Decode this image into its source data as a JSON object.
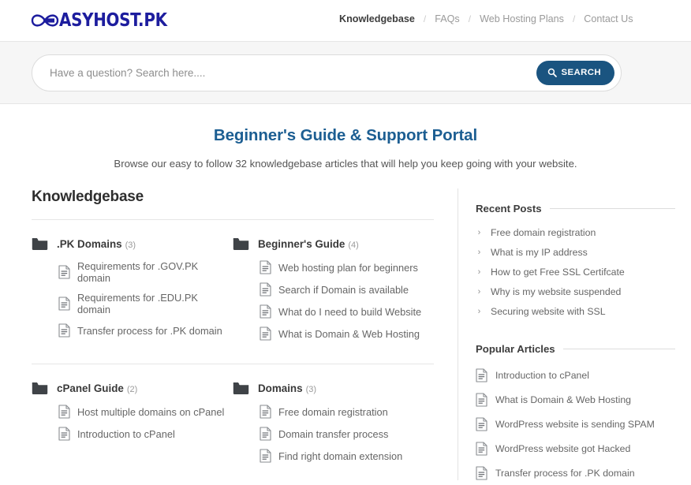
{
  "header": {
    "logo_text": "ASYHOST.PK",
    "logo_alt": "easyhost-pk-logo",
    "nav": [
      {
        "label": "Knowledgebase",
        "active": true
      },
      {
        "label": "FAQs",
        "active": false
      },
      {
        "label": "Web Hosting Plans",
        "active": false
      },
      {
        "label": "Contact Us",
        "active": false
      }
    ],
    "nav_separator": "/"
  },
  "search": {
    "placeholder": "Have a question? Search here....",
    "value": "",
    "button_label": "SEARCH",
    "button_icon": "search-icon",
    "button_color": "#1a5480"
  },
  "hero": {
    "title": "Beginner's Guide & Support Portal",
    "title_color": "#1c5e92",
    "subtitle": "Browse our easy to follow 32 knowledgebase articles that will help you keep going with your website."
  },
  "knowledgebase": {
    "heading": "Knowledgebase",
    "categories": [
      {
        "name": ".PK Domains",
        "count": "(3)",
        "icon": "folder-icon",
        "articles": [
          "Requirements for .GOV.PK domain",
          "Requirements for .EDU.PK domain",
          "Transfer process for .PK domain"
        ]
      },
      {
        "name": "Beginner's Guide",
        "count": "(4)",
        "icon": "folder-icon",
        "articles": [
          "Web hosting plan for beginners",
          "Search if Domain is available",
          "What do I need to build Website",
          "What is Domain & Web Hosting"
        ]
      },
      {
        "name": "cPanel Guide",
        "count": "(2)",
        "icon": "folder-icon",
        "articles": [
          "Host multiple domains on cPanel",
          "Introduction to cPanel"
        ]
      },
      {
        "name": "Domains",
        "count": "(3)",
        "icon": "folder-icon",
        "articles": [
          "Free domain registration",
          "Domain transfer process",
          "Find right domain extension"
        ]
      }
    ]
  },
  "sidebar": {
    "recent_posts": {
      "heading": "Recent Posts",
      "bullet_icon": "chevron-right-icon",
      "items": [
        "Free domain registration",
        "What is my IP address",
        "How to get Free SSL Certifcate",
        "Why is my website suspended",
        "Securing website with SSL"
      ]
    },
    "popular_articles": {
      "heading": "Popular Articles",
      "bullet_icon": "document-icon",
      "items": [
        "Introduction to cPanel",
        "What is Domain & Web Hosting",
        "WordPress website is sending SPAM",
        "WordPress website got Hacked",
        "Transfer process for .PK domain"
      ]
    }
  }
}
